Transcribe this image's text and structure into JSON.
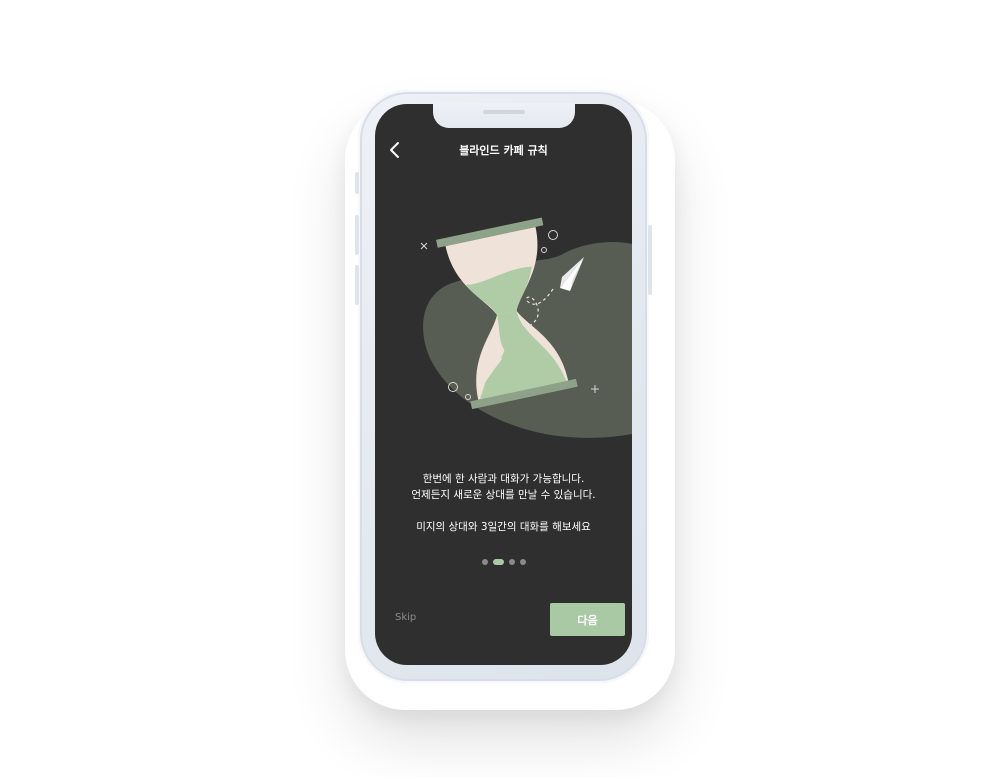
{
  "header": {
    "title": "블라인드 카페 규칙",
    "back_icon": "chevron-left-icon"
  },
  "onboarding": {
    "lines": [
      "한번에 한 사람과 대화가 가능합니다.",
      "언제든지 새로운 상대를 만날 수 있습니다.",
      "미지의 상대와 3일간의 대화를 해보세요"
    ],
    "page_indicator": {
      "total": 4,
      "current": 2
    }
  },
  "footer": {
    "skip_label": "Skip",
    "next_label": "다음"
  },
  "colors": {
    "screen_bg": "#2f2f2f",
    "accent": "#a9c9a4",
    "blob": "#575d53",
    "sand_light": "#efe2d8",
    "hourglass_cap": "#8ea28a"
  },
  "illustration": {
    "icons": [
      "hourglass-icon",
      "paper-plane-icon"
    ]
  }
}
